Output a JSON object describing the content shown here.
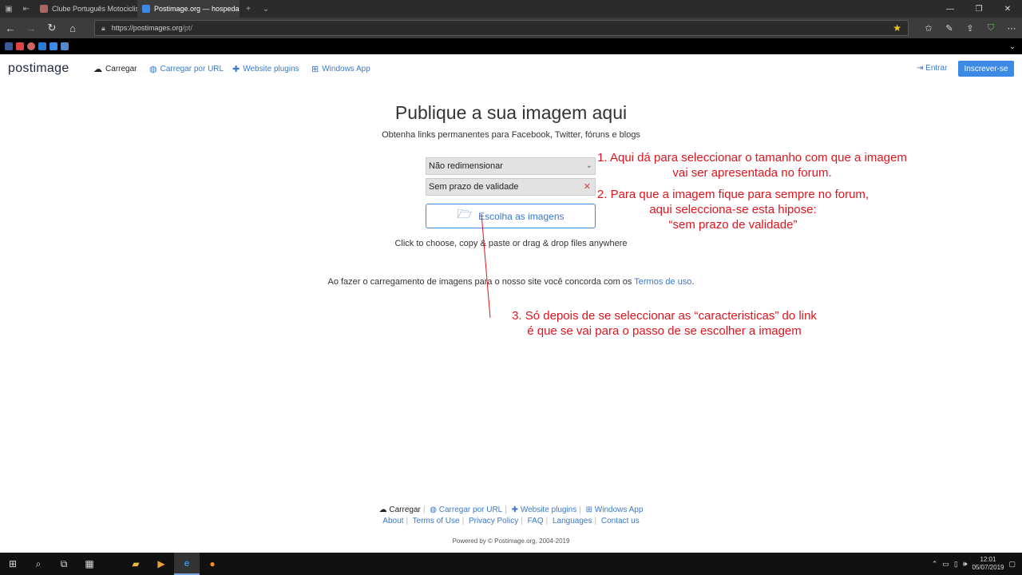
{
  "browser": {
    "tabs": [
      {
        "title": "Clube Português Motociclist",
        "active": false
      },
      {
        "title": "Postimage.org — hospedag",
        "active": true
      }
    ],
    "url_host": "https://postimages.org",
    "url_path": "/pt/"
  },
  "header": {
    "logo": "postimage",
    "nav": {
      "upload": "Carregar",
      "upload_url": "Carregar por URL",
      "plugins": "Website plugins",
      "windows_app": "Windows App"
    },
    "signin": "Entrar",
    "signup": "Inscrever-se"
  },
  "main": {
    "title": "Publique a sua imagem aqui",
    "subtitle": "Obtenha links permanentes para Facebook, Twitter, fóruns e blogs",
    "resize_select": "Não redimensionar",
    "expiry_select": "Sem prazo de validade",
    "choose_button": "Escolha as imagens",
    "hint": "Click to choose, copy & paste or drag & drop files anywhere",
    "terms_prefix": "Ao fazer o carregamento de imagens para o nosso site você concorda com os",
    "terms_link": "Termos de uso",
    "terms_suffix": "."
  },
  "annotations": {
    "note1_line1": "1. Aqui dá para seleccionar o tamanho com que a imagem",
    "note1_line2": "vai ser apresentada no forum.",
    "note2_line1": "2. Para que a imagem fique para sempre no forum,",
    "note2_line2": "aqui selecciona-se esta hipose:",
    "note2_line3": "“sem prazo de validade”",
    "note3_line1": "3. Só depois de se seleccionar as “caracteristicas” do link",
    "note3_line2": "é que se vai para o passo de se escolher a imagem",
    "color": "#e0141e"
  },
  "footer": {
    "upload": "Carregar",
    "upload_url": "Carregar por URL",
    "plugins": "Website plugins",
    "windows_app": "Windows App",
    "about": "About",
    "terms": "Terms of Use",
    "privacy": "Privacy Policy",
    "faq": "FAQ",
    "languages": "Languages",
    "contact": "Contact us",
    "powered": "Powered by © Postimage.org, 2004-2019"
  },
  "taskbar": {
    "time": "12:01",
    "date": "05/07/2019"
  },
  "colors": {
    "accent": "#3c8ae6",
    "link": "#3a78c9"
  }
}
